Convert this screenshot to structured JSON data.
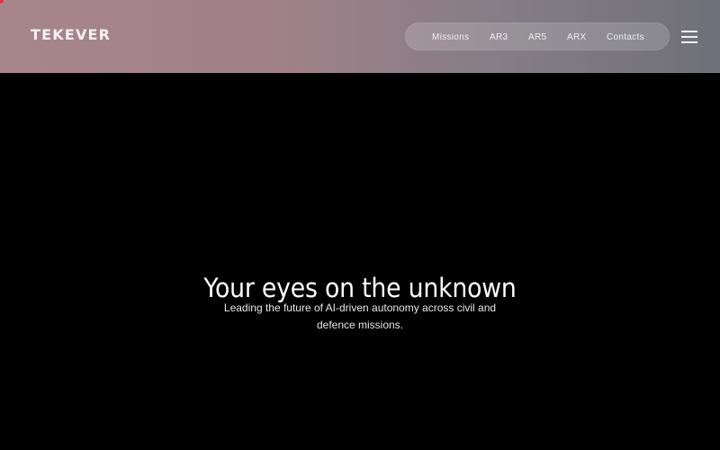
{
  "brand": {
    "logo_text": "TEKEVER"
  },
  "nav": {
    "items": [
      {
        "label": "Missions"
      },
      {
        "label": "AR3"
      },
      {
        "label": "AR5"
      },
      {
        "label": "ARX"
      },
      {
        "label": "Contacts"
      }
    ],
    "menu_icon": "hamburger-menu-icon"
  },
  "hero": {
    "title": "Your eyes on the unknown",
    "subtitle": "Leading the future of AI-driven autonomy across civil and defence missions."
  },
  "colors": {
    "header_gradient_start": "#a7868b",
    "header_gradient_end": "#6f7079",
    "background": "#000000",
    "text": "#ffffff",
    "accent_dot": "#e0343a"
  }
}
